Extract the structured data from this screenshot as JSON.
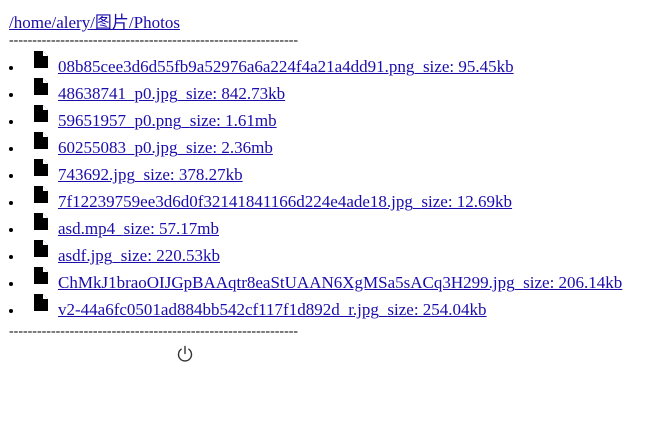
{
  "breadcrumb": {
    "path": "/home/alery/图片/Photos"
  },
  "dividers": {
    "top": "--------------------------------------------------------------",
    "bottom": "--------------------------------------------------------------"
  },
  "files": [
    {
      "name": "08b85cee3d6d55fb9a52976a6a224f4a21a4dd91.png",
      "size": "size: 95.45kb"
    },
    {
      "name": "48638741_p0.jpg",
      "size": "size: 842.73kb"
    },
    {
      "name": "59651957_p0.png",
      "size": "size: 1.61mb"
    },
    {
      "name": "60255083_p0.jpg",
      "size": "size: 2.36mb"
    },
    {
      "name": "743692.jpg",
      "size": "size: 378.27kb"
    },
    {
      "name": "7f12239759ee3d6d0f32141841166d224e4ade18.jpg",
      "size": "size: 12.69kb"
    },
    {
      "name": "asd.mp4",
      "size": "size: 57.17mb"
    },
    {
      "name": "asdf.jpg",
      "size": "size: 220.53kb"
    },
    {
      "name": "ChMkJ1braoOIJGpBAAqtr8eaStUAAN6XgMSa5sACq3H299.jpg",
      "size": "size: 206.14kb"
    },
    {
      "name": "v2-44a6fc0501ad884bb542cf117f1d892d_r.jpg",
      "size": "size: 254.04kb"
    }
  ],
  "icons": {
    "file": "file-icon",
    "power": "power-icon"
  }
}
